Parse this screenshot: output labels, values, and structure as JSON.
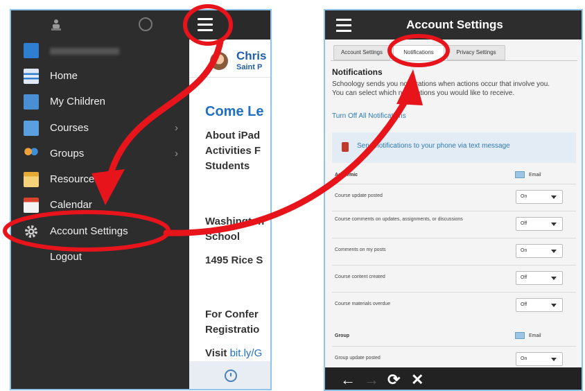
{
  "left_phone": {
    "drawer": {
      "items": [
        {
          "label": "Home"
        },
        {
          "label": "My Children"
        },
        {
          "label": "Courses"
        },
        {
          "label": "Groups"
        },
        {
          "label": "Resources"
        },
        {
          "label": "Calendar"
        },
        {
          "label": "Account Settings"
        },
        {
          "label": "Logout"
        }
      ]
    },
    "content": {
      "user_name": "Chris",
      "user_school": "Saint P",
      "heading": "Come Le",
      "about_line1": "About iPad",
      "about_line2": "Activities F",
      "about_line3": "Students",
      "address_line1": "Washington",
      "address_line2": "School",
      "address_line3": "1495 Rice S",
      "conf_line1": "For Confer",
      "conf_line2": "Registratio",
      "visit_label": "Visit",
      "visit_link": "bit.ly/G"
    }
  },
  "right_phone": {
    "title": "Account Settings",
    "tabs": [
      {
        "label": "Account Settings",
        "active": false
      },
      {
        "label": "Notifications",
        "active": true
      },
      {
        "label": "Privacy Settings",
        "active": false
      }
    ],
    "notifications_heading": "Notifications",
    "description": "Schoology sends you notifications when actions occur that involve you. You can select which notifications you would like to receive.",
    "turn_off_link": "Turn Off All Notifications",
    "sms_text": "Send notifications to your phone via text message",
    "sections": [
      {
        "label": "Academic",
        "email_label": "Email",
        "rows": [
          {
            "label": "Course update posted",
            "value": "On"
          },
          {
            "label": "Course comments on updates, assignments, or discussions",
            "value": "Off"
          },
          {
            "label": "Comments on my posts",
            "value": "On"
          },
          {
            "label": "Course content created",
            "value": "Off"
          },
          {
            "label": "Course materials overdue",
            "value": "Off"
          }
        ]
      },
      {
        "label": "Group",
        "email_label": "Email",
        "rows": [
          {
            "label": "Group update posted",
            "value": "On"
          }
        ]
      }
    ],
    "browser_bar": {
      "back": "←",
      "forward": "→",
      "reload": "⟳",
      "close": "✕"
    }
  },
  "colors": {
    "annotation_red": "#e8141b",
    "drawer_bg": "#2d2d2d",
    "link_blue": "#2c7bb6"
  }
}
